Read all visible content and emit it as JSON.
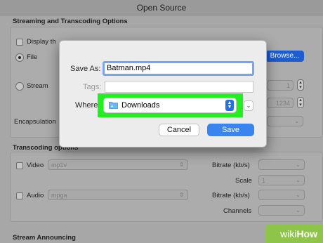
{
  "window": {
    "title": "Open Source"
  },
  "streaming": {
    "section_title": "Streaming and Transcoding Options",
    "display_label": "Display th",
    "file_label": "File",
    "browse_label": "Browse...",
    "stream_label": "Stream",
    "stream_value1": "1",
    "stream_value2": "1234",
    "encapsulation_label": "Encapsulation"
  },
  "transcoding": {
    "section_title": "Transcoding options",
    "video_label": "Video",
    "video_codec": "mp1v",
    "audio_label": "Audio",
    "audio_codec": "mpga",
    "bitrate_label": "Bitrate (kb/s)",
    "scale_label": "Scale",
    "scale_value": "1",
    "channels_label": "Channels"
  },
  "announcing": {
    "section_title": "Stream Announcing"
  },
  "dialog": {
    "save_as_label": "Save As:",
    "save_as_value": "Batman.mp4",
    "tags_label": "Tags:",
    "where_label": "Where",
    "where_value": "Downloads",
    "cancel_label": "Cancel",
    "save_label": "Save"
  },
  "watermark": {
    "wiki": "wiki",
    "how": "How"
  },
  "colors": {
    "highlight": "#22ee22",
    "accent": "#3a84ef"
  },
  "icons": {
    "folder": "folder-icon",
    "chevron": "chevron-updown-icon",
    "expand": "chevron-down-icon"
  }
}
